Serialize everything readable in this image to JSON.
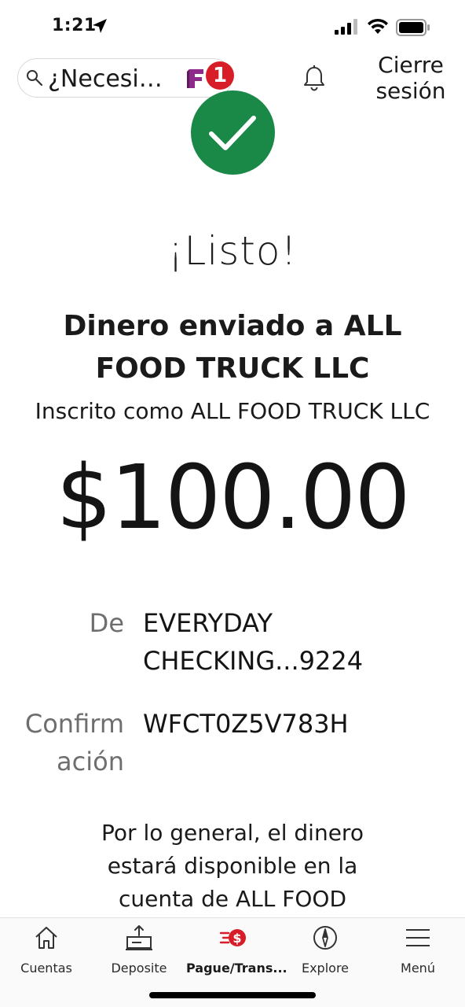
{
  "status_bar": {
    "time": "1:21"
  },
  "header": {
    "search_placeholder": "¿Necesi…",
    "fargo_badge_count": "1",
    "logout_line1": "Cierre",
    "logout_line2": "sesión"
  },
  "confirmation": {
    "title": "¡Listo!",
    "sent_to": "Dinero enviado a ALL FOOD TRUCK LLC",
    "enrolled_as": "Inscrito como ALL FOOD TRUCK LLC",
    "amount": "$100.00",
    "from_label": "De",
    "from_value_line1": "EVERYDAY",
    "from_value_line2": "CHECKING...9224",
    "confirmation_label_line1": "Confirm",
    "confirmation_label_line2": "ación",
    "confirmation_value": "WFCT0Z5V783H",
    "availability_line1": "Por lo general, el dinero",
    "availability_line2": "estará disponible en la",
    "availability_line3": "cuenta de ALL FOOD"
  },
  "bottom_nav": {
    "items": [
      {
        "label": "Cuentas",
        "icon": "home-icon"
      },
      {
        "label": "Deposite",
        "icon": "deposit-icon"
      },
      {
        "label": "Pague/Trans...",
        "icon": "pay-transfer-icon",
        "active": true
      },
      {
        "label": "Explore",
        "icon": "compass-icon"
      },
      {
        "label": "Menú",
        "icon": "menu-icon"
      }
    ]
  },
  "colors": {
    "success_green": "#1a8847",
    "brand_red": "#d71e28",
    "label_gray": "#6e6e6e"
  }
}
